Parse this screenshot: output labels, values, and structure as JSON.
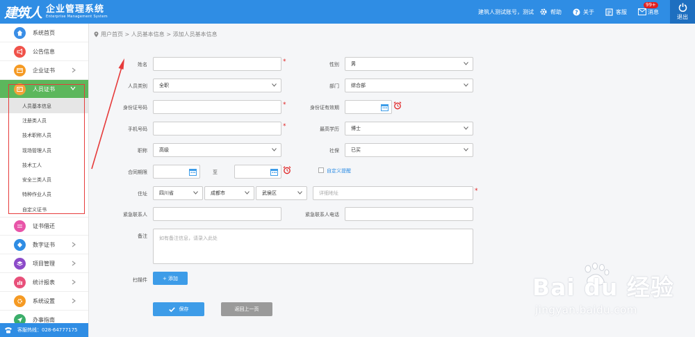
{
  "header": {
    "logo_main": "建筑人",
    "logo_cn": "企业管理系统",
    "logo_en": "Enterprise Management System",
    "account": "建筑人测试账号，测试",
    "help": "帮助",
    "about": "关于",
    "service": "客服",
    "message_badge": "99+",
    "message": "消息",
    "logout": "退出"
  },
  "sidebar": {
    "items": [
      {
        "label": "系统首页",
        "icon": "home-icon",
        "color": "#3a8ee6"
      },
      {
        "label": "公告信息",
        "icon": "megaphone-icon",
        "color": "#f0524a"
      },
      {
        "label": "企业证书",
        "icon": "certificate-icon",
        "color": "#f59a23"
      },
      {
        "label": "人员证书",
        "icon": "person-card-icon",
        "color": "#5cb75c"
      }
    ],
    "sub_items": [
      "人员基本信息",
      "注册类人员",
      "技术职称人员",
      "现场管理人员",
      "技术工人",
      "安全三类人员",
      "特种作业人员",
      "自定义证书"
    ],
    "items_after": [
      {
        "label": "证书借还",
        "icon": "swap-icon",
        "color": "#e855a8"
      },
      {
        "label": "数字证书",
        "icon": "digital-cert-icon",
        "color": "#2f8de4"
      },
      {
        "label": "项目管理",
        "icon": "layers-icon",
        "color": "#8c4bc9"
      },
      {
        "label": "统计报表",
        "icon": "bar-chart-icon",
        "color": "#e8507a"
      },
      {
        "label": "系统设置",
        "icon": "gear-icon",
        "color": "#f59a23"
      },
      {
        "label": "办事指南",
        "icon": "send-icon",
        "color": "#3cae6a"
      }
    ],
    "hotline": "客服热线：028-64777175"
  },
  "breadcrumb": "用户首页 > 人员基本信息 > 添加人员基本信息",
  "form": {
    "name_label": "姓名",
    "gender_label": "性别",
    "gender_value": "男",
    "category_label": "人员类别",
    "category_value": "全职",
    "department_label": "部门",
    "department_value": "综合部",
    "idcard_label": "身份证号码",
    "idcard_valid_label": "身份证有效期",
    "phone_label": "手机号码",
    "education_label": "最高学历",
    "education_value": "博士",
    "title_label": "职称",
    "title_value": "高级",
    "social_label": "社保",
    "social_value": "已买",
    "contract_label": "合同期限",
    "contract_to": "至",
    "custom_reminder": "自定义提醒",
    "address_label": "住址",
    "province": "四川省",
    "city": "成都市",
    "district": "武侯区",
    "address_placeholder": "详细地址",
    "emergency_label": "紧急联系人",
    "emergency_phone_label": "紧急联系人电话",
    "remark_label": "备注",
    "remark_placeholder": "如有备注信息，请录入此处",
    "scan_label": "扫描件",
    "add_button": "+ 添加",
    "save_button": "保存",
    "back_button": "返回上一页"
  },
  "watermark": {
    "text": "Bai du 经验",
    "url": "jingyan.baidu.com"
  }
}
